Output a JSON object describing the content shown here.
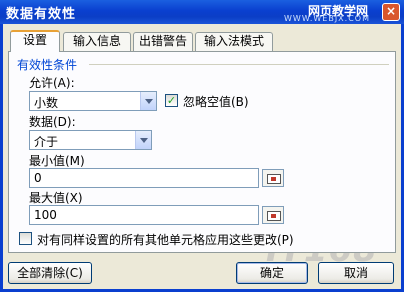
{
  "window": {
    "title": "数据有效性",
    "watermark_text": "网页教学网",
    "watermark_url": "WWW.WEBJX.COM",
    "close_glyph": "×"
  },
  "tabs": [
    {
      "label": "设置",
      "active": true
    },
    {
      "label": "输入信息",
      "active": false
    },
    {
      "label": "出错警告",
      "active": false
    },
    {
      "label": "输入法模式",
      "active": false
    }
  ],
  "criteria": {
    "group_title": "有效性条件",
    "allow_label": "允许(A):",
    "allow_value": "小数",
    "ignore_blank_label": "忽略空值(B)",
    "ignore_blank_checked": true,
    "data_label": "数据(D):",
    "data_value": "介于",
    "min_label": "最小值(M)",
    "min_value": "0",
    "max_label": "最大值(X)",
    "max_value": "100",
    "apply_all_label": "对有同样设置的所有其他单元格应用这些更改(P)",
    "apply_all_checked": false
  },
  "footer": {
    "clear_all_label": "全部清除(C)",
    "ok_label": "确定",
    "cancel_label": "取消",
    "logo_watermark": "IT168"
  },
  "colors": {
    "titlebar": "#0a3fcf",
    "group_title": "#0046d5",
    "dialog_bg": "#ece9d8"
  }
}
